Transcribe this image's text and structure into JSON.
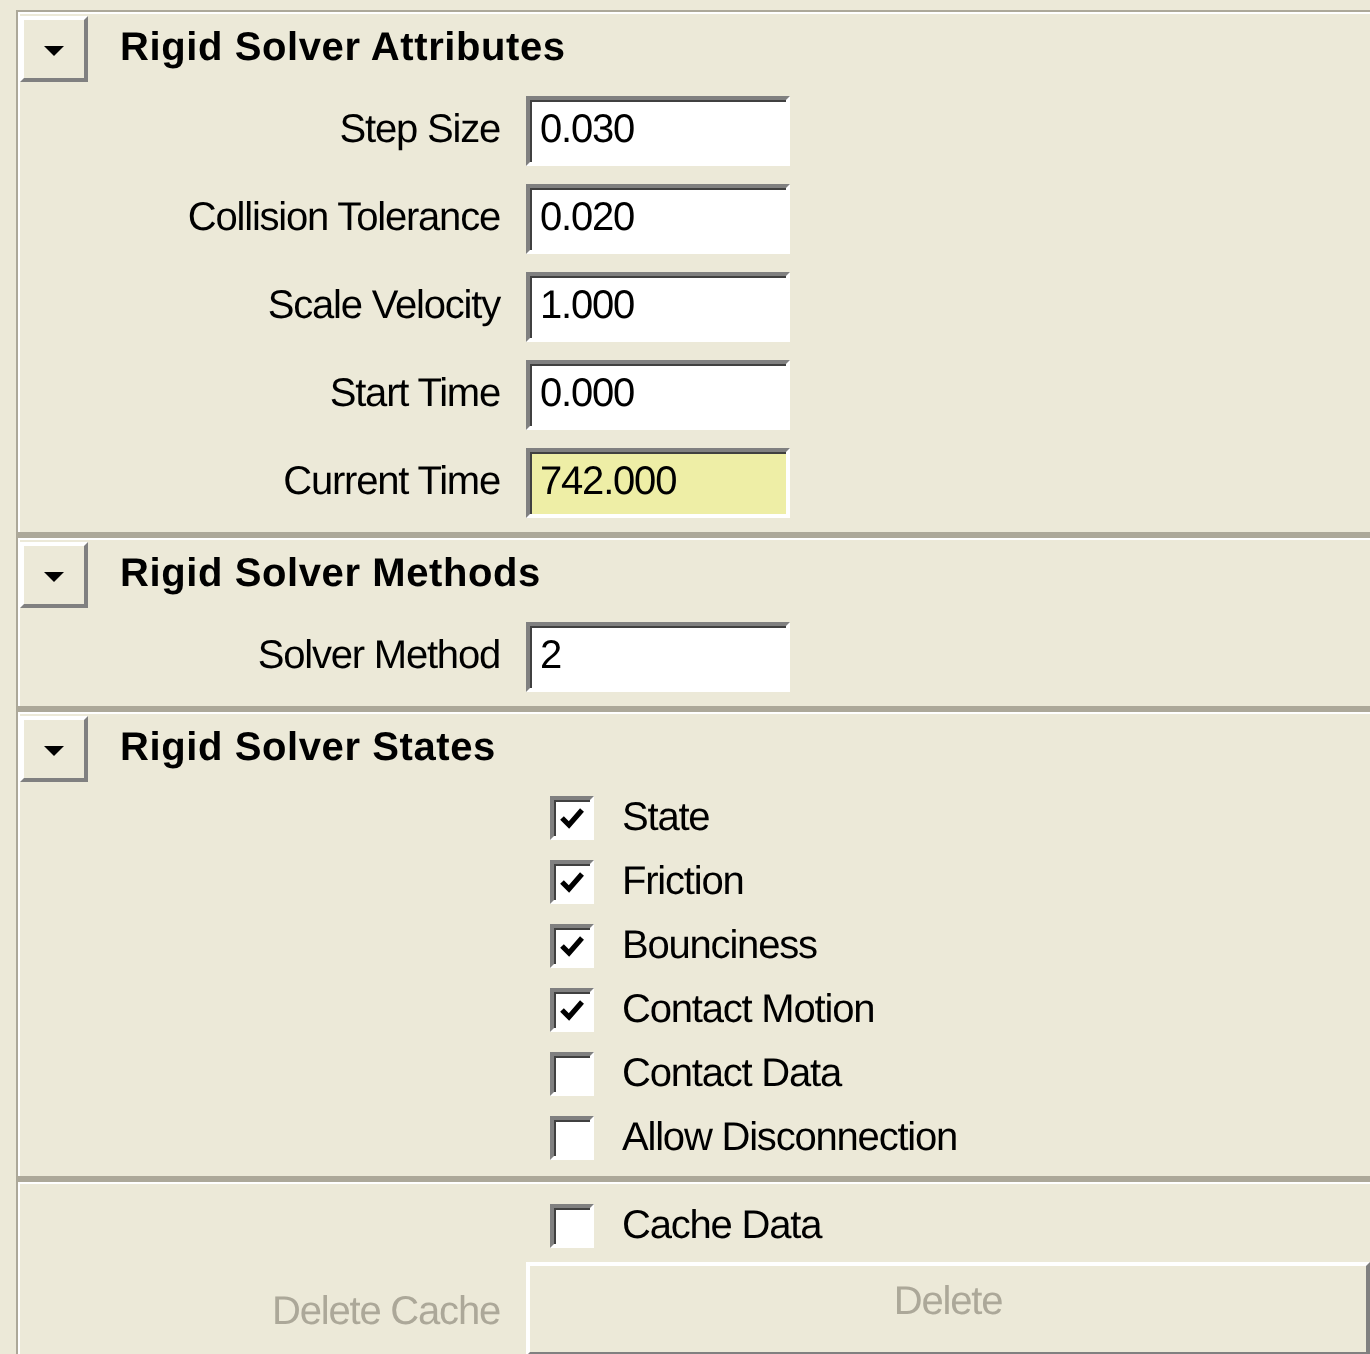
{
  "sections": [
    {
      "title": "Rigid Solver Attributes",
      "expanded": true,
      "rows": [
        {
          "kind": "field",
          "label": "Step Size",
          "value": "0.030",
          "highlighted": false
        },
        {
          "kind": "field",
          "label": "Collision Tolerance",
          "value": "0.020",
          "highlighted": false
        },
        {
          "kind": "field",
          "label": "Scale Velocity",
          "value": "1.000",
          "highlighted": false
        },
        {
          "kind": "field",
          "label": "Start Time",
          "value": "0.000",
          "highlighted": false
        },
        {
          "kind": "field",
          "label": "Current Time",
          "value": "742.000",
          "highlighted": true
        }
      ]
    },
    {
      "title": "Rigid Solver Methods",
      "expanded": true,
      "rows": [
        {
          "kind": "field",
          "label": "Solver Method",
          "value": "2",
          "highlighted": false
        }
      ]
    },
    {
      "title": "Rigid Solver States",
      "expanded": true,
      "rows": [
        {
          "kind": "check",
          "label": "State",
          "checked": true
        },
        {
          "kind": "check",
          "label": "Friction",
          "checked": true
        },
        {
          "kind": "check",
          "label": "Bounciness",
          "checked": true
        },
        {
          "kind": "check",
          "label": "Contact Motion",
          "checked": true
        },
        {
          "kind": "check",
          "label": "Contact Data",
          "checked": false
        },
        {
          "kind": "check",
          "label": "Allow Disconnection",
          "checked": false
        }
      ]
    }
  ],
  "footer": {
    "rows": [
      {
        "kind": "check",
        "label": "Cache Data",
        "checked": false
      },
      {
        "kind": "button",
        "label": "Delete Cache",
        "button": "Delete",
        "disabled": true
      }
    ]
  }
}
